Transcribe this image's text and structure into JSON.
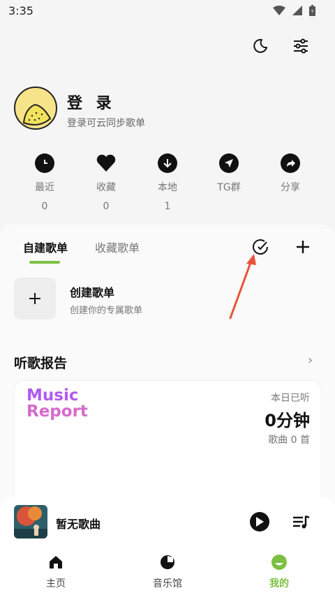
{
  "status_bar": {
    "time": "3:35"
  },
  "profile": {
    "title": "登 录",
    "subtitle": "登录可云同步歌单"
  },
  "stats": [
    {
      "label": "最近",
      "count": "0",
      "icon": "clock-icon"
    },
    {
      "label": "收藏",
      "count": "0",
      "icon": "heart-icon"
    },
    {
      "label": "本地",
      "count": "1",
      "icon": "download-icon"
    },
    {
      "label": "TG群",
      "count": "",
      "icon": "telegram-icon"
    },
    {
      "label": "分享",
      "count": "",
      "icon": "share-icon"
    }
  ],
  "playlist_tabs": {
    "active": "自建歌单",
    "inactive": "收藏歌单"
  },
  "create_playlist": {
    "title": "创建歌单",
    "subtitle": "创建你的专属歌单"
  },
  "report": {
    "heading": "听歌报告",
    "logo_line1": "Music",
    "logo_line2": "Report",
    "today_label": "本日已听",
    "today_value": "0分钟",
    "song_count": "歌曲 0 首"
  },
  "player": {
    "title": "暂无歌曲"
  },
  "bottom_nav": {
    "home": "主页",
    "music_hall": "音乐馆",
    "mine": "我的"
  },
  "colors": {
    "accent": "#7bc043",
    "annotation_arrow": "#e8533a",
    "logo_purple": "#b05bf1",
    "logo_pink": "#d66ac9"
  }
}
